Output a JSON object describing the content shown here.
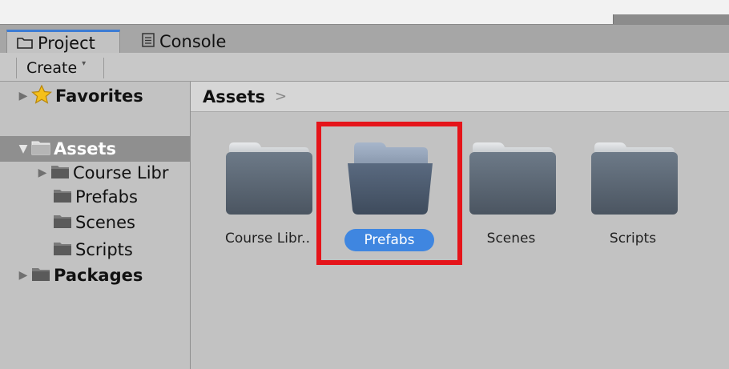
{
  "tabs": [
    {
      "label": "Project",
      "icon": "folder-icon",
      "active": true
    },
    {
      "label": "Console",
      "icon": "console-icon",
      "active": false
    }
  ],
  "toolbar": {
    "create_label": "Create",
    "create_caret": "▾"
  },
  "tree": {
    "favorites": {
      "label": "Favorites",
      "icon": "star-icon"
    },
    "assets": {
      "label": "Assets",
      "icon": "folder-icon",
      "selected": true
    },
    "children": [
      {
        "label": "Course Libr",
        "expandable": true
      },
      {
        "label": "Prefabs",
        "expandable": false
      },
      {
        "label": "Scenes",
        "expandable": false
      },
      {
        "label": "Scripts",
        "expandable": false
      }
    ],
    "packages": {
      "label": "Packages",
      "icon": "folder-icon"
    }
  },
  "breadcrumb": {
    "label": "Assets",
    "separator": ">"
  },
  "folders": [
    {
      "label": "Course Libr..",
      "selected": false
    },
    {
      "label": "Prefabs",
      "selected": true
    },
    {
      "label": "Scenes",
      "selected": false
    },
    {
      "label": "Scripts",
      "selected": false
    }
  ],
  "colors": {
    "selection": "#3f86e0",
    "highlight": "#e5141a",
    "panel": "#c2c2c2"
  }
}
